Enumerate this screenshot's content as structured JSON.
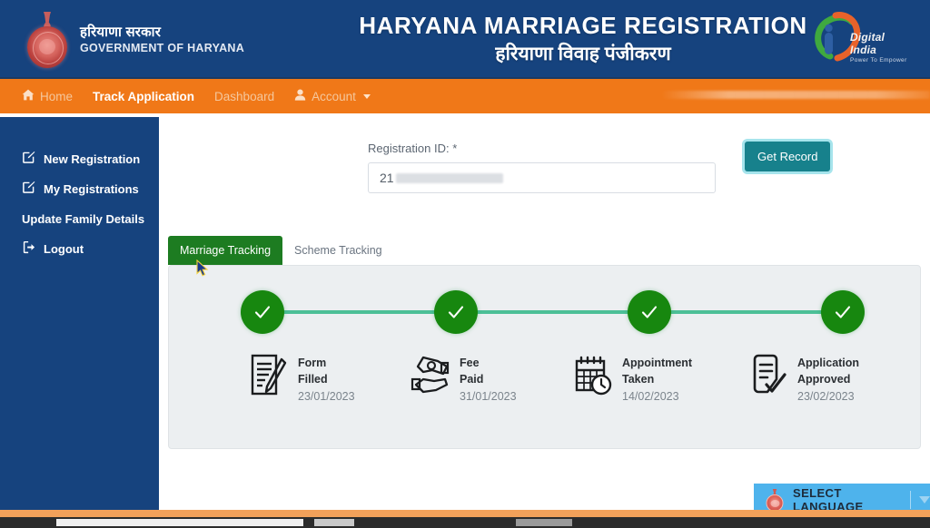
{
  "header": {
    "emblem_icon": "haryana-state-emblem",
    "brand_hindi": "हरियाणा सरकार",
    "brand_english": "GOVERNMENT OF HARYANA",
    "title_english": "HARYANA MARRIAGE REGISTRATION",
    "title_hindi": "हरियाणा विवाह पंजीकरण",
    "digital_india": {
      "logo_icon": "digital-india-logo",
      "name": "Digital India",
      "tagline": "Power To Empower"
    },
    "bg_color": "#16437e"
  },
  "navbar": {
    "bg_color": "#f07818",
    "items": [
      {
        "label": "Home",
        "icon": "home-icon",
        "active": false
      },
      {
        "label": "Track Application",
        "icon": "",
        "active": true
      },
      {
        "label": "Dashboard",
        "icon": "",
        "active": false
      },
      {
        "label": "Account",
        "icon": "user-icon",
        "active": false,
        "has_caret": true
      }
    ]
  },
  "sidebar": {
    "bg_color": "#16437e",
    "items": [
      {
        "label": "New Registration",
        "icon": "edit-square-icon"
      },
      {
        "label": "My Registrations",
        "icon": "edit-square-icon"
      },
      {
        "label": "Update Family Details",
        "icon": ""
      },
      {
        "label": "Logout",
        "icon": "logout-icon"
      }
    ]
  },
  "form": {
    "label": "Registration ID:",
    "required_mark": "*",
    "input_value": "21",
    "input_redacted": true,
    "button_label": "Get Record",
    "button_color": "#17818c"
  },
  "tabs": [
    {
      "label": "Marriage Tracking",
      "active": true
    },
    {
      "label": "Scheme Tracking",
      "active": false
    }
  ],
  "tracking": {
    "panel_bg": "#eceff1",
    "node_color": "#17870f",
    "rail_color": "#4cbf97",
    "node_icon": "check-icon",
    "steps": [
      {
        "line1": "Form",
        "line2": "Filled",
        "date": "23/01/2023",
        "icon": "document-pen-icon",
        "complete": true
      },
      {
        "line1": "Fee",
        "line2": "Paid",
        "date": "31/01/2023",
        "icon": "money-hands-icon",
        "complete": true
      },
      {
        "line1": "Appointment",
        "line2": "Taken",
        "date": "14/02/2023",
        "icon": "calendar-clock-icon",
        "complete": true
      },
      {
        "line1": "Application",
        "line2": "Approved",
        "date": "23/02/2023",
        "icon": "document-check-icon",
        "complete": true
      }
    ]
  },
  "language_bar": {
    "label": "SELECT LANGUAGE",
    "emblem_icon": "haryana-state-emblem",
    "caret_icon": "caret-down-icon",
    "bg_color": "#4eb3ec"
  }
}
